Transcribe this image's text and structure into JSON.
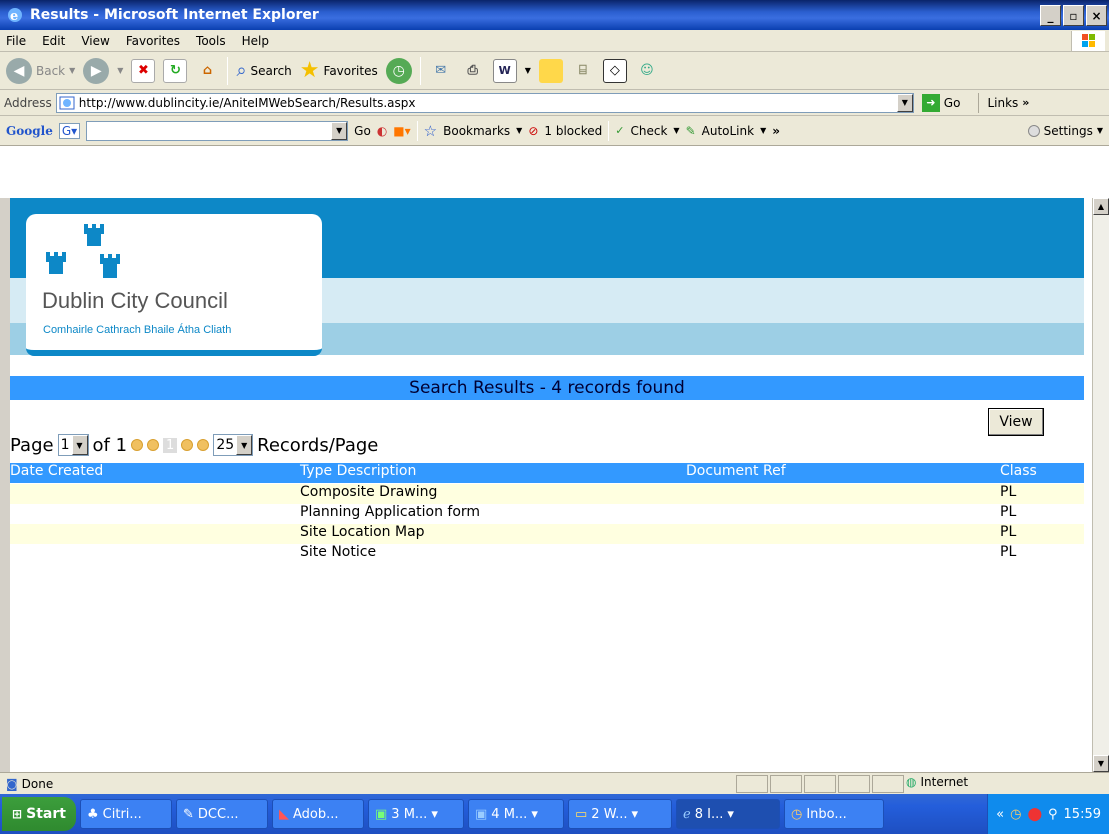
{
  "window": {
    "title": "Results - Microsoft Internet Explorer",
    "min": "_",
    "max": "▫",
    "close": "×"
  },
  "menu": [
    "File",
    "Edit",
    "View",
    "Favorites",
    "Tools",
    "Help"
  ],
  "toolbar": {
    "back": "Back",
    "search": "Search",
    "favorites": "Favorites"
  },
  "address": {
    "label": "Address",
    "url": "http://www.dublincity.ie/AniteIMWebSearch/Results.aspx",
    "go": "Go",
    "links": "Links"
  },
  "google": {
    "brand": "Google",
    "go": "Go",
    "bookmarks": "Bookmarks",
    "blocked": "1 blocked",
    "check": "Check",
    "autolink": "AutoLink",
    "settings": "Settings"
  },
  "page": {
    "council_name": "Dublin City Council",
    "council_irish": "Comhairle Cathrach Bhaile Átha Cliath",
    "results_title": "Search Results - 4 records found",
    "view_button": "View",
    "pager": {
      "page_label": "Page",
      "page_value": "1",
      "of_label": "of 1",
      "current": "1",
      "per_page_value": "25",
      "records_label": "Records/Page"
    },
    "table": {
      "headers": [
        "Date Created",
        "Type Description",
        "Document Ref",
        "Class"
      ],
      "rows": [
        [
          "",
          "Composite Drawing",
          "",
          "PL"
        ],
        [
          "",
          "Planning Application form",
          "",
          "PL"
        ],
        [
          "",
          "Site Location Map",
          "",
          "PL"
        ],
        [
          "",
          "Site Notice",
          "",
          "PL"
        ]
      ]
    }
  },
  "status": {
    "text": "Done",
    "zone": "Internet"
  },
  "taskbar": {
    "start": "Start",
    "tasks": [
      "Citri...",
      "DCC...",
      "Adob...",
      "3 M...",
      "4 M...",
      "2 W...",
      "8 I...",
      "Inbo..."
    ],
    "clock": "15:59"
  },
  "colors": {
    "dcc_blue": "#0d88c7",
    "results_bar": "#3399ff",
    "alt_row": "#ffffe0"
  }
}
